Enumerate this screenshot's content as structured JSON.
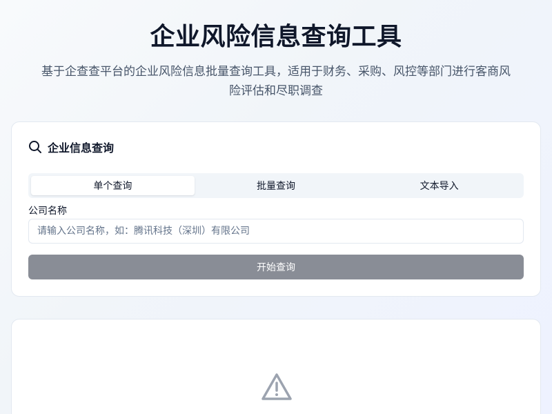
{
  "header": {
    "title": "企业风险信息查询工具",
    "subtitle": "基于企查查平台的企业风险信息批量查询工具，适用于财务、采购、风控等部门进行客商风险评估和尽职调查"
  },
  "query_card": {
    "icon": "search-icon",
    "title": "企业信息查询",
    "tabs": [
      {
        "label": "单个查询",
        "active": true
      },
      {
        "label": "批量查询",
        "active": false
      },
      {
        "label": "文本导入",
        "active": false
      }
    ],
    "field_label": "公司名称",
    "input_value": "",
    "input_placeholder": "请输入公司名称，如：腾讯科技（深圳）有限公司",
    "submit_label": "开始查询",
    "submit_disabled": true
  },
  "empty_card": {
    "icon": "warning-triangle-icon"
  },
  "colors": {
    "primary_text": "#0f172a",
    "muted_text": "#475569",
    "border": "#e2e8f0",
    "disabled_button": "#898d96",
    "icon_gray": "#9ca3af"
  }
}
